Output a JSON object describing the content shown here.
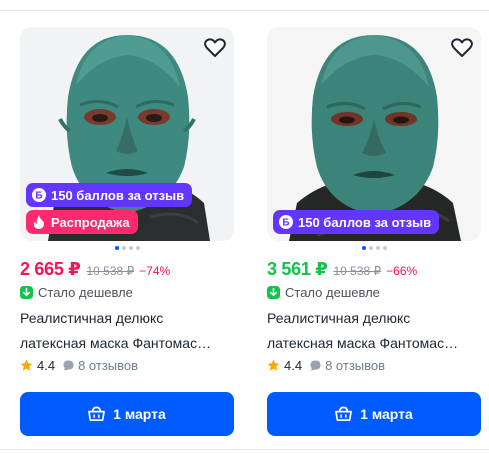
{
  "products": [
    {
      "points_badge": "150 баллов за отзыв",
      "sale_badge": "Распродажа",
      "price": "2 665 ₽",
      "price_color": "#f91155",
      "old_price": "10 538 ₽",
      "discount": "−74%",
      "cheaper_label": "Стало дешевле",
      "title_line1": "Реалистичная делюкс",
      "title_line2": "латексная маска Фантомас…",
      "rating": "4.4",
      "reviews": "8 отзывов",
      "button_label": "1 марта",
      "image_count": 4,
      "active_image": 1
    },
    {
      "points_badge": "150 баллов за отзыв",
      "price": "3 561 ₽",
      "price_color": "#10c44c",
      "old_price": "10 538 ₽",
      "discount": "−66%",
      "cheaper_label": "Стало дешевле",
      "title_line1": "Реалистичная делюкс",
      "title_line2": "латексная маска Фантомас…",
      "rating": "4.4",
      "reviews": "8 отзывов",
      "button_label": "1 марта",
      "image_count": 4,
      "active_image": 1
    }
  ],
  "icons": {
    "favorite": "heart-outline-icon",
    "points": "ozon-b-coin-icon",
    "sale": "fire-icon",
    "cheaper": "arrow-down-green-icon",
    "rating": "star-icon",
    "reviews": "chat-bubble-icon",
    "cart": "basket-icon"
  },
  "colors": {
    "accent": "#005bff",
    "points_badge": "#6236ff",
    "sale_badge": "#ff2a6d",
    "price_red": "#f91155",
    "price_green": "#10c44c",
    "star": "#ffa800"
  }
}
